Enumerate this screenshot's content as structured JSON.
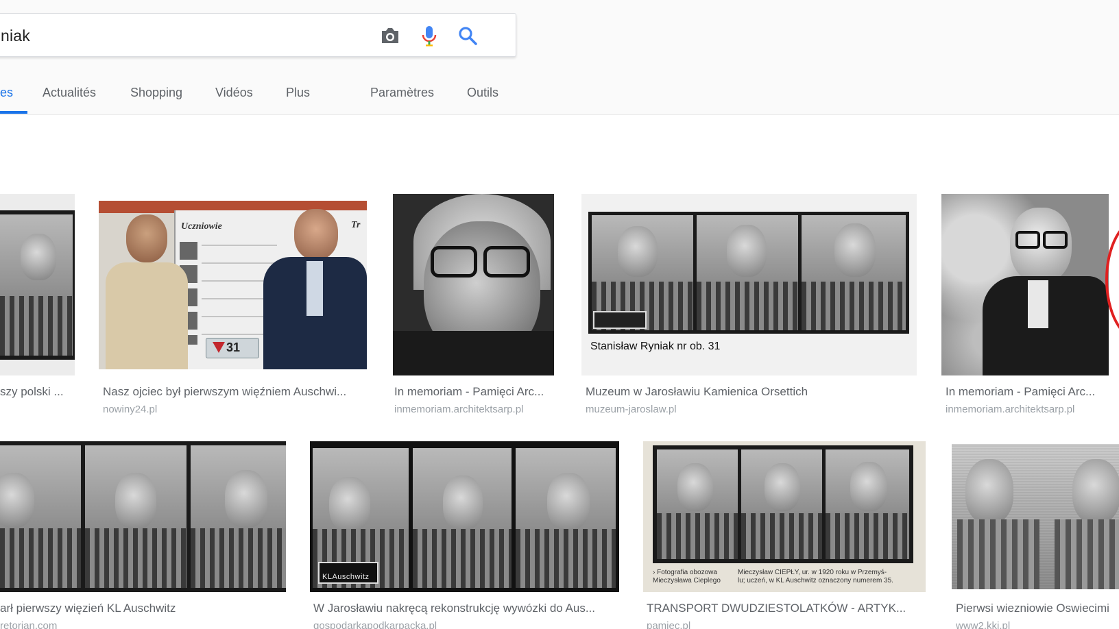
{
  "search": {
    "query": "niak",
    "camera_icon": "camera-icon",
    "mic_icon": "microphone-icon",
    "search_icon": "search-icon"
  },
  "tabs": {
    "images": "es",
    "news": "Actualités",
    "shopping": "Shopping",
    "videos": "Vidéos",
    "more": "Plus",
    "settings": "Paramètres",
    "tools": "Outils"
  },
  "results": [
    {
      "caption": "szy polski ...",
      "source": ""
    },
    {
      "caption": "Nasz ojciec był pierwszym więźniem Auschwi...",
      "source": "nowiny24.pl",
      "sign_title": "Uczniowie",
      "sign_title2": "Tr",
      "badge": "31"
    },
    {
      "caption": "In memoriam - Pamięci Arc...",
      "source": "inmemoriam.architektsarp.pl"
    },
    {
      "caption": "Muzeum w Jarosławiu Kamienica Orsettich",
      "source": "muzeum-jaroslaw.pl",
      "image_text": "Stanisław  Ryniak nr ob. 31"
    },
    {
      "caption": "In memoriam - Pamięci Arc...",
      "source": "inmemoriam.architektsarp.pl"
    },
    {
      "caption": "arł pierwszy więzień KL Auschwitz",
      "source": "retorian.com"
    },
    {
      "caption": "W Jarosławiu nakręcą rekonstrukcję wywózki do Aus...",
      "source": "gospodarkapodkarpacka.pl",
      "plate": "KLAuschwitz"
    },
    {
      "caption": "TRANSPORT DWUDZIESTOLATKÓW - ARTYK...",
      "source": "pamiec.pl",
      "note_left": "› Fotografia obozowa\nMieczysława Cieplego",
      "note_right": "Mieczysław CIEPŁY, ur. w 1920 roku w Przemyś-\nlu; uczeń, w KL Auschwitz oznaczony numerem 35."
    },
    {
      "caption": "Pierwsi wiezniowie Oswiecimi",
      "source": "www2.kki.pl"
    }
  ],
  "colors": {
    "accent": "#1a73e8",
    "caption": "#5f6368",
    "source": "#9aa0a6"
  }
}
